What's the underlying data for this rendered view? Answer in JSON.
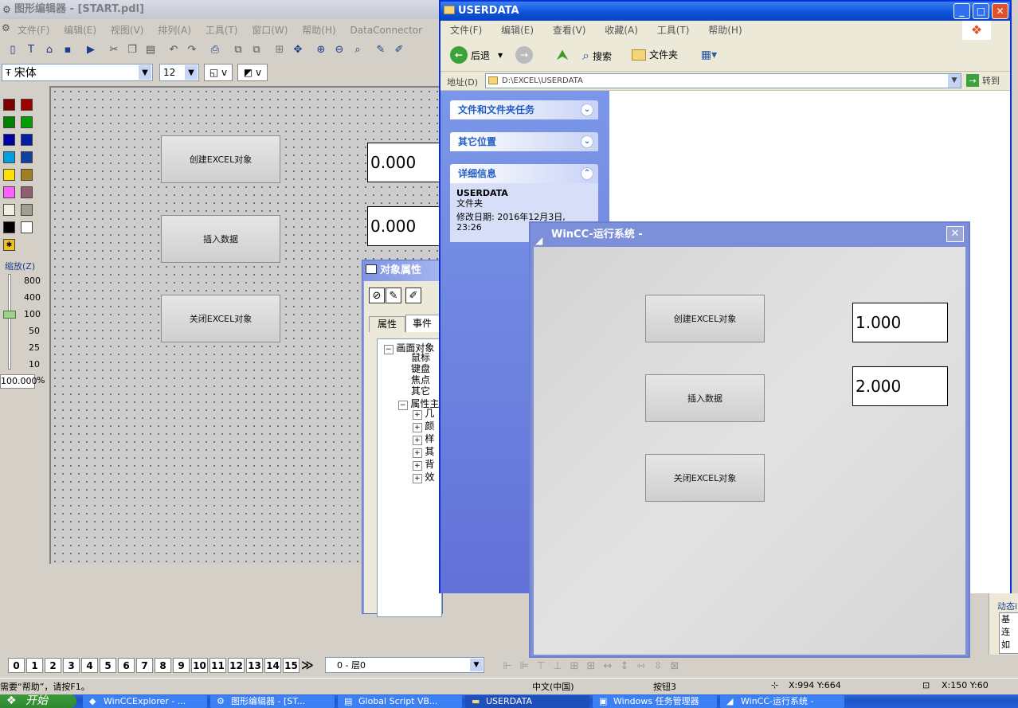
{
  "editor": {
    "title": "图形编辑器 - [START.pdl]",
    "menu": [
      "文件(F)",
      "编辑(E)",
      "视图(V)",
      "排列(A)",
      "工具(T)",
      "窗口(W)",
      "帮助(H)",
      "DataConnector"
    ],
    "font_name": "宋体",
    "font_size": "12",
    "canvas_buttons": [
      "创建EXCEL对象",
      "插入数据",
      "关闭EXCEL对象"
    ],
    "canvas_values": [
      "0.000",
      "0.000"
    ],
    "palette_colors": [
      "#800000",
      "#a00000",
      "#008000",
      "#00a000",
      "#0000a0",
      "#0020a0",
      "#00a0e0",
      "#1040a0",
      "#ffe000",
      "#a08020",
      "#ff60ff",
      "#906070",
      "#f0f0e0",
      "#a0a090",
      "#000000",
      "#ffffff"
    ],
    "zoom_label": "缩放(Z)",
    "zoom_levels": [
      "800",
      "400",
      "100",
      "50",
      "25",
      "10"
    ],
    "zoom_value": "100.000",
    "zoom_unit": "%"
  },
  "props": {
    "title": "对象属性",
    "tabs": [
      "属性",
      "事件"
    ],
    "tree_root": "画面对象",
    "tree_events": [
      "鼠标",
      "键盘",
      "焦点",
      "其它"
    ],
    "tree_props_root": "属性主",
    "tree_props": [
      "几",
      "颜",
      "样",
      "其",
      "背",
      "效"
    ]
  },
  "explorer": {
    "title": "USERDATA",
    "menu": [
      "文件(F)",
      "编辑(E)",
      "查看(V)",
      "收藏(A)",
      "工具(T)",
      "帮助(H)"
    ],
    "back_label": "后退",
    "search_label": "搜索",
    "folders_label": "文件夹",
    "address_label": "地址(D)",
    "address_value": "D:\\EXCEL\\USERDATA",
    "go_label": "转到",
    "panels": [
      "文件和文件夹任务",
      "其它位置",
      "详细信息"
    ],
    "detail_name": "USERDATA",
    "detail_type": "文件夹",
    "detail_modified": "修改日期: 2016年12月3日,",
    "detail_time": "23:26"
  },
  "runtime": {
    "title": "WinCC-运行系统 -",
    "buttons": [
      "创建EXCEL对象",
      "插入数据",
      "关闭EXCEL对象"
    ],
    "values": [
      "1.000",
      "2.000"
    ]
  },
  "layers": {
    "numbers": [
      "0",
      "1",
      "2",
      "3",
      "4",
      "5",
      "6",
      "7",
      "8",
      "9",
      "10",
      "11",
      "12",
      "13",
      "14",
      "15"
    ],
    "more": "≫",
    "selected": "0 - 层0"
  },
  "right_panel": {
    "title": "动态i",
    "items": [
      "基",
      "连",
      "如"
    ]
  },
  "status": {
    "help": "需要“帮助”，请按F1。",
    "language": "中文(中国)",
    "object": "按钮3",
    "position": "X:994 Y:664",
    "size": "X:150 Y:60"
  },
  "taskbar": {
    "start": "开始",
    "items": [
      "WinCCExplorer - ...",
      "图形编辑器 - [ST...",
      "Global Script VB...",
      "USERDATA",
      "Windows 任务管理器",
      "WinCC-运行系统 -"
    ]
  }
}
